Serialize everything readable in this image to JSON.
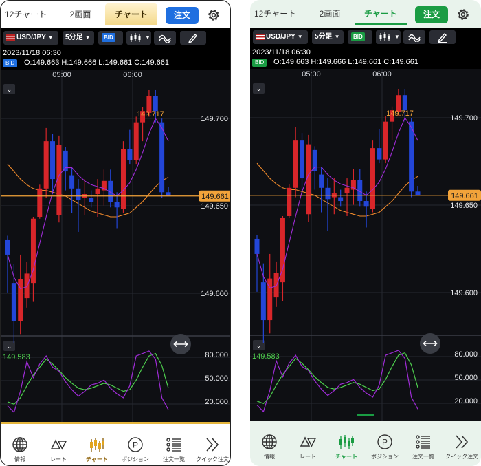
{
  "tabs": [
    "12チャート",
    "2画面",
    "チャート"
  ],
  "order_label": "注文",
  "toolbar": {
    "pair": "USD/JPY",
    "timeframe": "5分足",
    "bid": "BID"
  },
  "info": {
    "datetime": "2023/11/18 06:30",
    "bid_tag": "BID",
    "ohlc": "O:149.663  H:149.666  L:149.661  C:149.661"
  },
  "time_labels": [
    "05:00",
    "06:00"
  ],
  "price_labels": [
    "149.700",
    "149.650",
    "149.600"
  ],
  "high_label": "149.717",
  "low_label": "149.583",
  "current_price": "149.661",
  "osc_labels": [
    "80.000",
    "50.000",
    "20.000"
  ],
  "nav": [
    {
      "label": "情報",
      "icon": "globe-icon"
    },
    {
      "label": "レート",
      "icon": "rate-triangles-icon"
    },
    {
      "label": "チャート",
      "icon": "candlestick-chart-icon"
    },
    {
      "label": "ポジション",
      "icon": "position-p-icon"
    },
    {
      "label": "注文一覧",
      "icon": "order-list-icon"
    },
    {
      "label": "クイック注文",
      "icon": "double-chevron-right-icon"
    }
  ],
  "themes": [
    {
      "name": "gold",
      "accent": "#f3d889",
      "order": "#1f6fe0"
    },
    {
      "name": "green",
      "accent": "#1a9c43",
      "order": "#1a9c43"
    }
  ],
  "chart_data": {
    "type": "candlestick",
    "ylim": [
      149.575,
      149.725
    ],
    "candles": [
      {
        "o": 149.638,
        "h": 149.64,
        "l": 149.61,
        "c": 149.63
      },
      {
        "o": 149.615,
        "h": 149.625,
        "l": 149.583,
        "c": 149.595
      },
      {
        "o": 149.595,
        "h": 149.63,
        "l": 149.588,
        "c": 149.617
      },
      {
        "o": 149.607,
        "h": 149.626,
        "l": 149.602,
        "c": 149.62
      },
      {
        "o": 149.615,
        "h": 149.65,
        "l": 149.605,
        "c": 149.649
      },
      {
        "o": 149.65,
        "h": 149.667,
        "l": 149.649,
        "c": 149.665
      },
      {
        "o": 149.665,
        "h": 149.697,
        "l": 149.66,
        "c": 149.69
      },
      {
        "o": 149.69,
        "h": 149.694,
        "l": 149.662,
        "c": 149.67
      },
      {
        "o": 149.651,
        "h": 149.693,
        "l": 149.647,
        "c": 149.688
      },
      {
        "o": 149.685,
        "h": 149.687,
        "l": 149.664,
        "c": 149.674
      },
      {
        "o": 149.672,
        "h": 149.676,
        "l": 149.652,
        "c": 149.665
      },
      {
        "o": 149.665,
        "h": 149.67,
        "l": 149.642,
        "c": 149.659
      },
      {
        "o": 149.66,
        "h": 149.67,
        "l": 149.651,
        "c": 149.662
      },
      {
        "o": 149.66,
        "h": 149.664,
        "l": 149.655,
        "c": 149.658
      },
      {
        "o": 149.662,
        "h": 149.67,
        "l": 149.65,
        "c": 149.665
      },
      {
        "o": 149.664,
        "h": 149.675,
        "l": 149.656,
        "c": 149.669
      },
      {
        "o": 149.669,
        "h": 149.675,
        "l": 149.655,
        "c": 149.658
      },
      {
        "o": 149.658,
        "h": 149.663,
        "l": 149.644,
        "c": 149.655
      },
      {
        "o": 149.654,
        "h": 149.69,
        "l": 149.652,
        "c": 149.686
      },
      {
        "o": 149.686,
        "h": 149.696,
        "l": 149.678,
        "c": 149.68
      },
      {
        "o": 149.68,
        "h": 149.703,
        "l": 149.678,
        "c": 149.7
      },
      {
        "o": 149.7,
        "h": 149.708,
        "l": 149.69,
        "c": 149.706
      },
      {
        "o": 149.705,
        "h": 149.717,
        "l": 149.703,
        "c": 149.714
      },
      {
        "o": 149.714,
        "h": 149.717,
        "l": 149.7,
        "c": 149.706
      },
      {
        "o": 149.7,
        "h": 149.702,
        "l": 149.66,
        "c": 149.663
      },
      {
        "o": 149.663,
        "h": 149.666,
        "l": 149.661,
        "c": 149.661
      }
    ],
    "ma_fast": [
      149.63,
      149.618,
      149.612,
      149.613,
      149.622,
      149.636,
      149.65,
      149.663,
      149.672,
      149.676,
      149.676,
      149.672,
      149.669,
      149.667,
      149.666,
      149.665,
      149.663,
      149.661,
      149.664,
      149.668,
      149.675,
      149.684,
      149.694,
      149.702,
      149.697,
      149.69
    ],
    "ma_slow": [
      149.678,
      149.674,
      149.67,
      149.667,
      149.665,
      149.664,
      149.664,
      149.663,
      149.662,
      149.661,
      149.659,
      149.657,
      149.655,
      149.653,
      149.652,
      149.651,
      149.65,
      149.65,
      149.651,
      149.652,
      149.655,
      149.658,
      149.662,
      149.666,
      149.669,
      149.671
    ],
    "osc": {
      "ylim": [
        0,
        100
      ],
      "k": [
        20,
        12,
        38,
        75,
        55,
        72,
        82,
        68,
        63,
        50,
        40,
        32,
        38,
        46,
        48,
        52,
        42,
        35,
        30,
        45,
        82,
        85,
        88,
        78,
        30,
        15
      ],
      "d": [
        25,
        22,
        30,
        45,
        58,
        68,
        78,
        72,
        64,
        55,
        48,
        42,
        40,
        42,
        45,
        48,
        46,
        42,
        38,
        40,
        52,
        68,
        82,
        85,
        70,
        42
      ]
    }
  }
}
